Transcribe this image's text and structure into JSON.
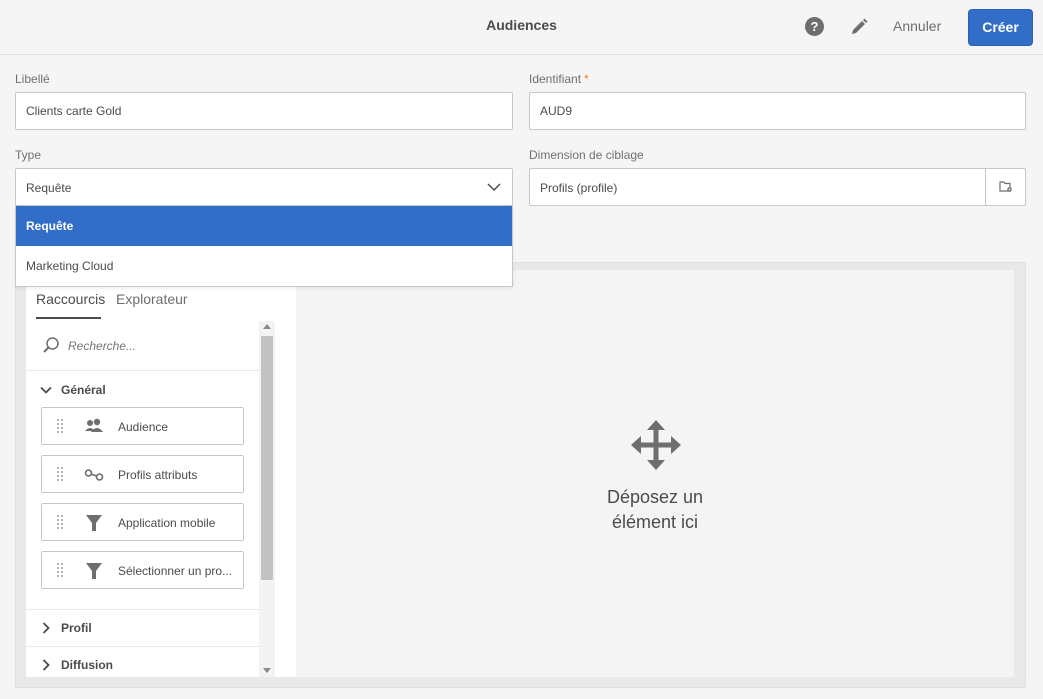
{
  "header": {
    "title": "Audiences",
    "help_icon": "?",
    "cancel_label": "Annuler",
    "create_label": "Créer",
    "accent_color": "#326ec8"
  },
  "form": {
    "label_field": {
      "label": "Libellé",
      "value": "Clients carte Gold"
    },
    "id_field": {
      "label": "Identifiant",
      "required_mark": "*",
      "value": "AUD9"
    },
    "type_field": {
      "label": "Type",
      "value": "Requête",
      "options": [
        "Requête",
        "Marketing Cloud"
      ]
    },
    "target_field": {
      "label": "Dimension de ciblage",
      "value": "Profils (profile)"
    }
  },
  "palette": {
    "tabs": [
      "Raccourcis",
      "Explorateur"
    ],
    "search_placeholder": "Recherche...",
    "sections": {
      "general": "Général",
      "profile": "Profil",
      "delivery": "Diffusion"
    },
    "items": [
      {
        "label": "Audience",
        "icon": "audience-icon"
      },
      {
        "label": "Profils attributs",
        "icon": "link-icon"
      },
      {
        "label": "Application mobile",
        "icon": "filter-icon"
      },
      {
        "label": "Sélectionner un pro...",
        "icon": "filter-icon"
      }
    ]
  },
  "canvas": {
    "drop_line1": "Déposez un",
    "drop_line2": "élément ici"
  }
}
